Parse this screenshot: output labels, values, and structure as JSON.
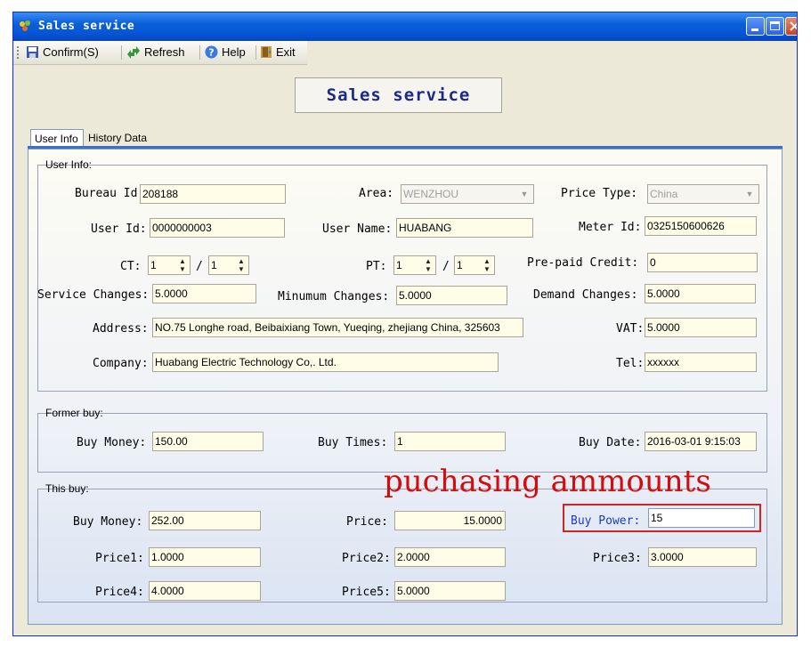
{
  "window": {
    "title": "Sales service"
  },
  "toolbar": {
    "confirm_label": "Confirm(S)",
    "refresh_label": "Refresh",
    "help_label": "Help",
    "exit_label": "Exit"
  },
  "banner": "Sales service",
  "tabs": [
    {
      "label": "User Info",
      "active": true
    },
    {
      "label": "History Data",
      "active": false
    }
  ],
  "user_info": {
    "group_label": "User Info:",
    "bureau_id": {
      "label": "Bureau Id:",
      "value": "208188"
    },
    "area": {
      "label": "Area:",
      "value": "WENZHOU"
    },
    "price_type": {
      "label": "Price Type:",
      "value": "China"
    },
    "user_id": {
      "label": "User Id:",
      "value": "0000000003"
    },
    "user_name": {
      "label": "User Name:",
      "value": "HUABANG"
    },
    "meter_id": {
      "label": "Meter Id:",
      "value": "0325150600626"
    },
    "ct": {
      "label": "CT:",
      "num": "1",
      "sep": "/",
      "den": "1"
    },
    "pt": {
      "label": "PT:",
      "num": "1",
      "sep": "/",
      "den": "1"
    },
    "prepaid_credit": {
      "label": "Pre-paid Credit:",
      "value": "0"
    },
    "service_changes": {
      "label": "Service Changes:",
      "value": "5.0000"
    },
    "minimum_changes": {
      "label": "Minumum Changes:",
      "value": "5.0000"
    },
    "demand_changes": {
      "label": "Demand Changes:",
      "value": "5.0000"
    },
    "address": {
      "label": "Address:",
      "value": "NO.75 Longhe road, Beibaixiang Town, Yueqing, zhejiang China, 325603"
    },
    "vat": {
      "label": "VAT:",
      "value": "5.0000"
    },
    "company": {
      "label": "Company:",
      "value": "Huabang Electric Technology Co,. Ltd."
    },
    "tel": {
      "label": "Tel:",
      "value": "xxxxxx"
    }
  },
  "former_buy": {
    "group_label": "Former buy:",
    "buy_money": {
      "label": "Buy Money:",
      "value": "150.00"
    },
    "buy_times": {
      "label": "Buy Times:",
      "value": "1"
    },
    "buy_date": {
      "label": "Buy Date:",
      "value": "2016-03-01 9:15:03"
    }
  },
  "this_buy": {
    "group_label": "This buy:",
    "buy_money": {
      "label": "Buy Money:",
      "value": "252.00"
    },
    "price": {
      "label": "Price:",
      "value": "15.0000"
    },
    "buy_power": {
      "label": "Buy Power:",
      "value": "15"
    },
    "price1": {
      "label": "Price1:",
      "value": "1.0000"
    },
    "price2": {
      "label": "Price2:",
      "value": "2.0000"
    },
    "price3": {
      "label": "Price3:",
      "value": "3.0000"
    },
    "price4": {
      "label": "Price4:",
      "value": "4.0000"
    },
    "price5": {
      "label": "Price5:",
      "value": "5.0000"
    }
  },
  "annotation": "puchasing ammounts",
  "colors": {
    "titlebar": "#0553d4",
    "annotation": "#d40c0c",
    "buy_power_label": "#1a3cc8"
  }
}
